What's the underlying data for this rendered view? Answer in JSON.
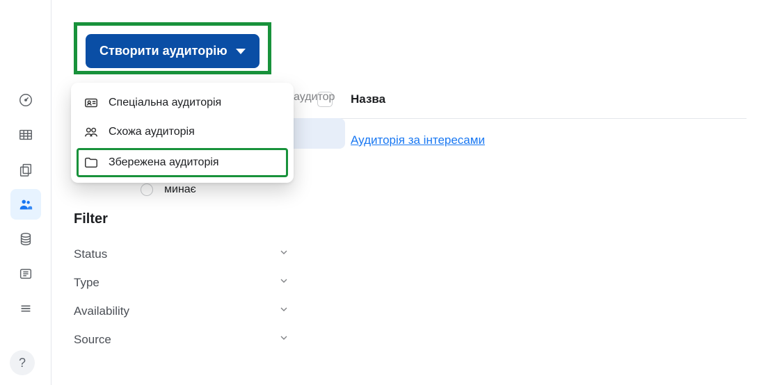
{
  "create_button": {
    "label": "Створити аудиторію"
  },
  "dropdown": {
    "items": [
      {
        "label": "Спеціальна аудиторія"
      },
      {
        "label": "Схожа аудиторія"
      },
      {
        "label": "Збережена аудиторія"
      }
    ]
  },
  "peek_input_hint": "аудитор",
  "hidden_radio_label": "минає",
  "filter": {
    "title": "Filter",
    "rows": [
      {
        "label": "Status"
      },
      {
        "label": "Type"
      },
      {
        "label": "Availability"
      },
      {
        "label": "Source"
      }
    ]
  },
  "table": {
    "header": {
      "name": "Назва"
    },
    "rows": [
      {
        "name": "Аудиторія за інтересами"
      }
    ]
  },
  "help_label": "?"
}
